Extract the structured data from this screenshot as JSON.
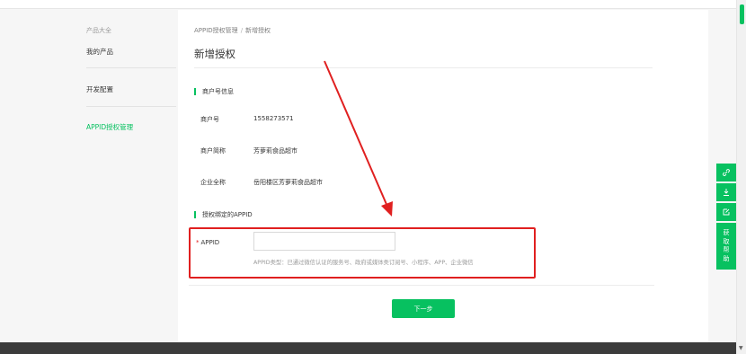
{
  "sidebar": {
    "section_title": "产品大全",
    "items": [
      {
        "label": "我的产品"
      },
      {
        "label": "开发配置"
      },
      {
        "label": "APPID授权管理"
      }
    ]
  },
  "breadcrumb": {
    "parent": "APPID授权管理",
    "separator": "/",
    "current": "新增授权"
  },
  "page": {
    "title": "新增授权"
  },
  "merchant": {
    "section_title": "商户号信息",
    "rows": [
      {
        "label": "商户号",
        "value": "1558273571"
      },
      {
        "label": "商户简称",
        "value": "芳萝莉食品超市"
      },
      {
        "label": "企业全称",
        "value": "岳阳楼区芳萝莉食品超市"
      }
    ]
  },
  "binding": {
    "section_title": "授权绑定的APPID",
    "appid_required_mark": "*",
    "appid_label": "APPID",
    "appid_value": "",
    "appid_tip": "APPID类型：已通过微信认证的服务号、政府或媒体类订阅号、小程序、APP、企业微信"
  },
  "actions": {
    "next_label": "下一步"
  },
  "float_tools": {
    "items": [
      "link-icon",
      "download-icon",
      "edit-icon"
    ],
    "help_chars": [
      "获",
      "取",
      "帮",
      "助"
    ]
  },
  "colors": {
    "accent": "#07c160",
    "annotation": "#e02020"
  }
}
